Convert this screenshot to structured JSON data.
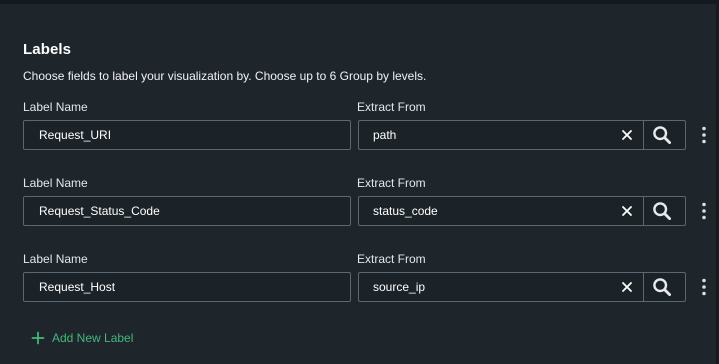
{
  "section": {
    "title": "Labels",
    "description": "Choose fields to label your visualization by. Choose up to 6 Group by levels."
  },
  "labels": [
    {
      "label_name_caption": "Label Name",
      "extract_caption": "Extract From",
      "label_name": "Request_URI",
      "extract_from": "path"
    },
    {
      "label_name_caption": "Label Name",
      "extract_caption": "Extract From",
      "label_name": "Request_Status_Code",
      "extract_from": "status_code"
    },
    {
      "label_name_caption": "Label Name",
      "extract_caption": "Extract From",
      "label_name": "Request_Host",
      "extract_from": "source_ip"
    }
  ],
  "add_button": {
    "label": "Add New Label",
    "icon": "plus-icon"
  },
  "icons": {
    "clear": "close-icon",
    "search": "search-icon",
    "more": "kebab-menu-icon"
  },
  "colors": {
    "background": "#1e252b",
    "input_border": "#5d6770",
    "accent_green": "#43b87a",
    "text": "#ffffff"
  }
}
